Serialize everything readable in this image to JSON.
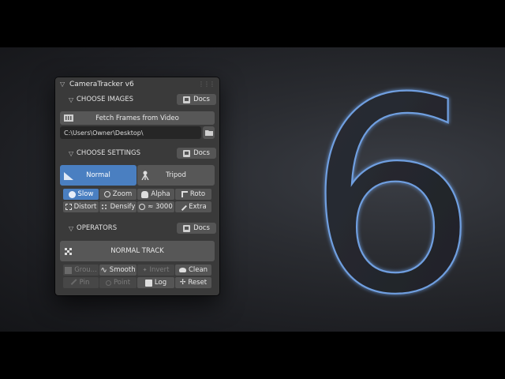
{
  "panel": {
    "title": "CameraTracker v6"
  },
  "sections": {
    "images": {
      "label": "CHOOSE IMAGES",
      "docs": "Docs"
    },
    "settings": {
      "label": "CHOOSE SETTINGS",
      "docs": "Docs"
    },
    "operators": {
      "label": "OPERATORS",
      "docs": "Docs"
    }
  },
  "images": {
    "fetch_label": "Fetch Frames from Video",
    "path_value": "C:\\Users\\Owner\\Desktop\\"
  },
  "settings": {
    "modes": [
      {
        "label": "Normal",
        "active": true
      },
      {
        "label": "Tripod",
        "active": false
      }
    ],
    "options": [
      {
        "label": "Slow",
        "icon": "snail-icon",
        "active": true
      },
      {
        "label": "Zoom",
        "icon": "magnifier-icon",
        "active": false
      },
      {
        "label": "Alpha",
        "icon": "alpha-icon",
        "active": false
      },
      {
        "label": "Roto",
        "icon": "roto-icon",
        "active": false
      },
      {
        "label": "Distort",
        "icon": "distort-icon",
        "active": false
      },
      {
        "label": "Densify",
        "icon": "densify-icon",
        "active": false
      },
      {
        "label": "≈ 3000",
        "icon": "target-icon",
        "active": false
      },
      {
        "label": "Extra",
        "icon": "wrench-icon",
        "active": false
      }
    ]
  },
  "operators": {
    "track_label": "NORMAL TRACK",
    "buttons": [
      {
        "label": "Grou...",
        "icon": "group-icon",
        "disabled": true
      },
      {
        "label": "Smooth",
        "icon": "smooth-icon",
        "disabled": false
      },
      {
        "label": "Invert",
        "icon": "invert-icon",
        "disabled": true
      },
      {
        "label": "Clean",
        "icon": "clean-icon",
        "disabled": false
      },
      {
        "label": "Pin",
        "icon": "pin-icon",
        "disabled": true
      },
      {
        "label": "Point",
        "icon": "point-icon",
        "disabled": true
      },
      {
        "label": "Log",
        "icon": "log-icon",
        "disabled": false
      },
      {
        "label": "Reset",
        "icon": "reset-icon",
        "disabled": false
      }
    ]
  },
  "hero": {
    "numeral": "6"
  },
  "colors": {
    "accent": "#4a7fc1",
    "panel": "#3a3a3a",
    "button": "#575757"
  }
}
